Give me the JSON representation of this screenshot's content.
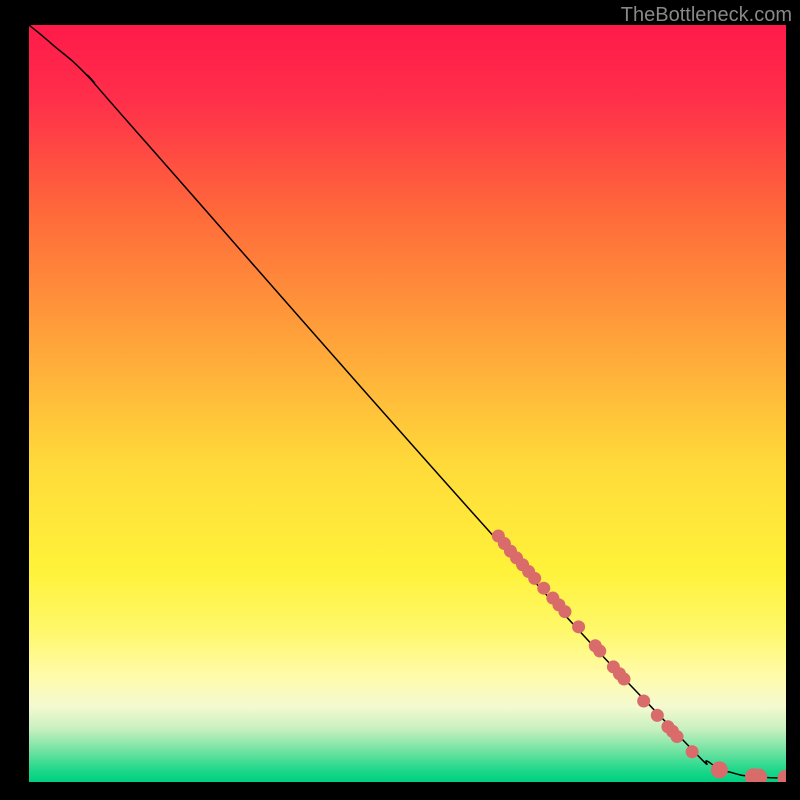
{
  "watermark": "TheBottleneck.com",
  "chart_data": {
    "type": "line",
    "title": "",
    "xlabel": "",
    "ylabel": "",
    "xlim": [
      0,
      100
    ],
    "ylim": [
      0,
      100
    ],
    "background_gradient": {
      "stops": [
        {
          "offset": 0.0,
          "color": "#ff1a4a"
        },
        {
          "offset": 0.1,
          "color": "#ff2f4a"
        },
        {
          "offset": 0.25,
          "color": "#ff6a3a"
        },
        {
          "offset": 0.42,
          "color": "#ffa43a"
        },
        {
          "offset": 0.58,
          "color": "#ffda3a"
        },
        {
          "offset": 0.72,
          "color": "#fff23a"
        },
        {
          "offset": 0.8,
          "color": "#fff86a"
        },
        {
          "offset": 0.86,
          "color": "#fffbaa"
        },
        {
          "offset": 0.9,
          "color": "#f4fad0"
        },
        {
          "offset": 0.93,
          "color": "#c7f0c0"
        },
        {
          "offset": 0.96,
          "color": "#6de2a0"
        },
        {
          "offset": 0.985,
          "color": "#1cd78a"
        },
        {
          "offset": 1.0,
          "color": "#00cf80"
        }
      ]
    },
    "curve": [
      {
        "x": 0,
        "y": 100
      },
      {
        "x": 3,
        "y": 97.5
      },
      {
        "x": 8,
        "y": 93
      },
      {
        "x": 15,
        "y": 85
      },
      {
        "x": 60,
        "y": 34
      },
      {
        "x": 85,
        "y": 7
      },
      {
        "x": 90,
        "y": 2.5
      },
      {
        "x": 93,
        "y": 1.2
      },
      {
        "x": 96,
        "y": 0.7
      },
      {
        "x": 100.3,
        "y": 0.5
      }
    ],
    "points": {
      "color": "#d96b6b",
      "radius_small": 6.5,
      "radius_large": 8.5,
      "xy": [
        [
          62,
          32.5
        ],
        [
          62.8,
          31.5
        ],
        [
          63.6,
          30.5
        ],
        [
          64.4,
          29.6
        ],
        [
          65.2,
          28.7
        ],
        [
          66.0,
          27.8
        ],
        [
          66.8,
          26.9
        ],
        [
          68.0,
          25.6
        ],
        [
          69.2,
          24.3
        ],
        [
          70.0,
          23.4
        ],
        [
          70.8,
          22.5
        ],
        [
          72.6,
          20.5
        ],
        [
          74.8,
          18.0
        ],
        [
          75.4,
          17.3
        ],
        [
          77.2,
          15.2
        ],
        [
          78.0,
          14.3
        ],
        [
          78.6,
          13.6
        ],
        [
          81.2,
          10.7
        ],
        [
          83.0,
          8.8
        ],
        [
          84.4,
          7.3
        ],
        [
          85.0,
          6.7
        ],
        [
          85.6,
          6.0
        ],
        [
          87.6,
          4.0
        ],
        [
          91.2,
          1.6
        ],
        [
          95.7,
          0.7
        ],
        [
          96.4,
          0.65
        ],
        [
          100.0,
          0.5
        ],
        [
          100.5,
          0.5
        ]
      ]
    }
  }
}
